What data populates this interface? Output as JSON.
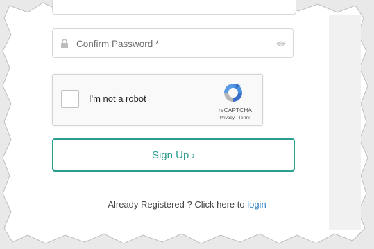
{
  "form": {
    "confirm_password_placeholder": "Confirm Password *",
    "lock_icon": "lock-icon",
    "eye_icon": "eye-icon"
  },
  "captcha": {
    "label": "I'm not a robot",
    "brand": "reCAPTCHA",
    "links": "Privacy - Terms",
    "logo_icon": "recaptcha-logo-icon"
  },
  "signup": {
    "label": "Sign Up",
    "chevron": "›",
    "accent": "#2a9d8f"
  },
  "login": {
    "text": "Already Registered ? Click here to ",
    "link": "login",
    "link_color": "#2f80c4"
  }
}
